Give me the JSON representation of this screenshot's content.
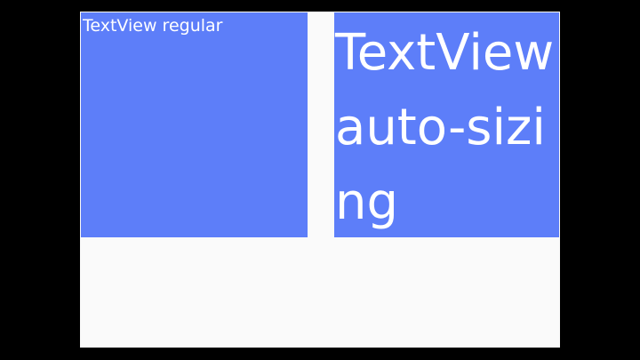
{
  "colors": {
    "background": "#000000",
    "frame": "#fafafa",
    "textview_fill": "#5d7ef9",
    "text": "#ffffff"
  },
  "textviews": {
    "regular": "TextView regular",
    "autosizing": "TextView auto-sizing"
  }
}
